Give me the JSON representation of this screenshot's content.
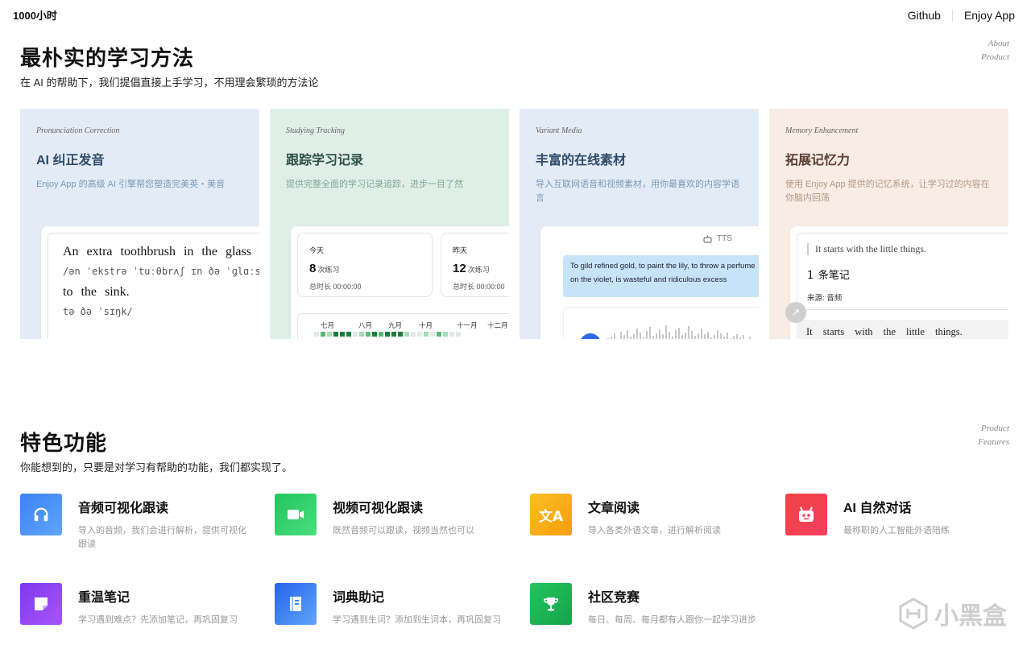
{
  "header": {
    "brand": "1000小时",
    "nav": [
      "Github",
      "Enjoy App"
    ]
  },
  "methods": {
    "title": "最朴实的学习方法",
    "subtitle": "在 AI 的帮助下，我们提倡直接上手学习，不用理会繁琐的方法论",
    "tag": [
      "About",
      "Product"
    ],
    "cards": [
      {
        "tag": "Pronunciation Correction",
        "title": "AI 纠正发音",
        "desc": "Enjoy App 的高级 AI 引擎帮您塑造完美英・美音"
      },
      {
        "tag": "Studying Tracking",
        "title": "跟踪学习记录",
        "desc": "提供完整全面的学习记录追踪，进步一目了然"
      },
      {
        "tag": "Variant Media",
        "title": "丰富的在线素材",
        "desc": "导入互联网语音和视频素材，用你最喜欢的内容学语言"
      },
      {
        "tag": "Memory Enhancement",
        "title": "拓展记忆力",
        "desc": "使用 Enjoy App 提供的记忆系统，让学习过的内容在你脑内回荡"
      }
    ],
    "pron": {
      "line1": "An extra toothbrush in the glass",
      "ipa1": "/ən ˈekstrə ˈtuːθbrʌʃ ɪn ðə ˈɡlɑːs",
      "line2": "to the sink.",
      "ipa2": "tə ðə ˈsɪŋk/"
    },
    "tracking": {
      "today": {
        "label": "今天",
        "count": "8",
        "unit": "次练习",
        "duration": "总时长 00:00:00"
      },
      "yesterday": {
        "label": "昨天",
        "count": "12",
        "unit": "次练习",
        "duration": "总时长 00:00:00"
      },
      "months": [
        "七月",
        "八月",
        "九月",
        "十月",
        "十一月",
        "十二月"
      ]
    },
    "media": {
      "tts": "TTS",
      "text": "To gild refined gold, to paint the lily, to throw a perfume on the violet, is wasteful and ridiculous excess"
    },
    "memory": {
      "quote": "It starts with the little things.",
      "count": "1",
      "count_label": "条笔记",
      "source": "来源: 音频",
      "quote2": "It starts with the little things."
    }
  },
  "features": {
    "title": "特色功能",
    "subtitle": "你能想到的，只要是对学习有帮助的功能，我们都实现了。",
    "tag": [
      "Product",
      "Features"
    ],
    "items": [
      {
        "title": "音频可视化跟读",
        "desc": "导入的音频，我们会进行解析，提供可视化跟读",
        "color": "#3b82f6",
        "icon": "headphones-icon"
      },
      {
        "title": "视频可视化跟读",
        "desc": "既然音频可以跟读，视频当然也可以",
        "color": "#22c55e",
        "icon": "video-icon"
      },
      {
        "title": "文章阅读",
        "desc": "导入各类外语文章，进行解析阅读",
        "color": "#fbbf24",
        "icon": "translate-icon"
      },
      {
        "title": "AI 自然对话",
        "desc": "最称职的人工智能外语陪练",
        "color": "#f43f5e",
        "icon": "robot-icon"
      },
      {
        "title": "重温笔记",
        "desc": "学习遇到难点？先添加笔记，再巩固复习",
        "color": "#8b5cf6",
        "icon": "note-icon"
      },
      {
        "title": "词典助记",
        "desc": "学习遇到生词？添加到生词本，再巩固复习",
        "color": "#3b82f6",
        "icon": "dictionary-icon"
      },
      {
        "title": "社区竞赛",
        "desc": "每日、每周、每月都有人跟你一起学习进步",
        "color": "#22c55e",
        "icon": "trophy-icon"
      }
    ]
  },
  "watermark": "小黑盒"
}
